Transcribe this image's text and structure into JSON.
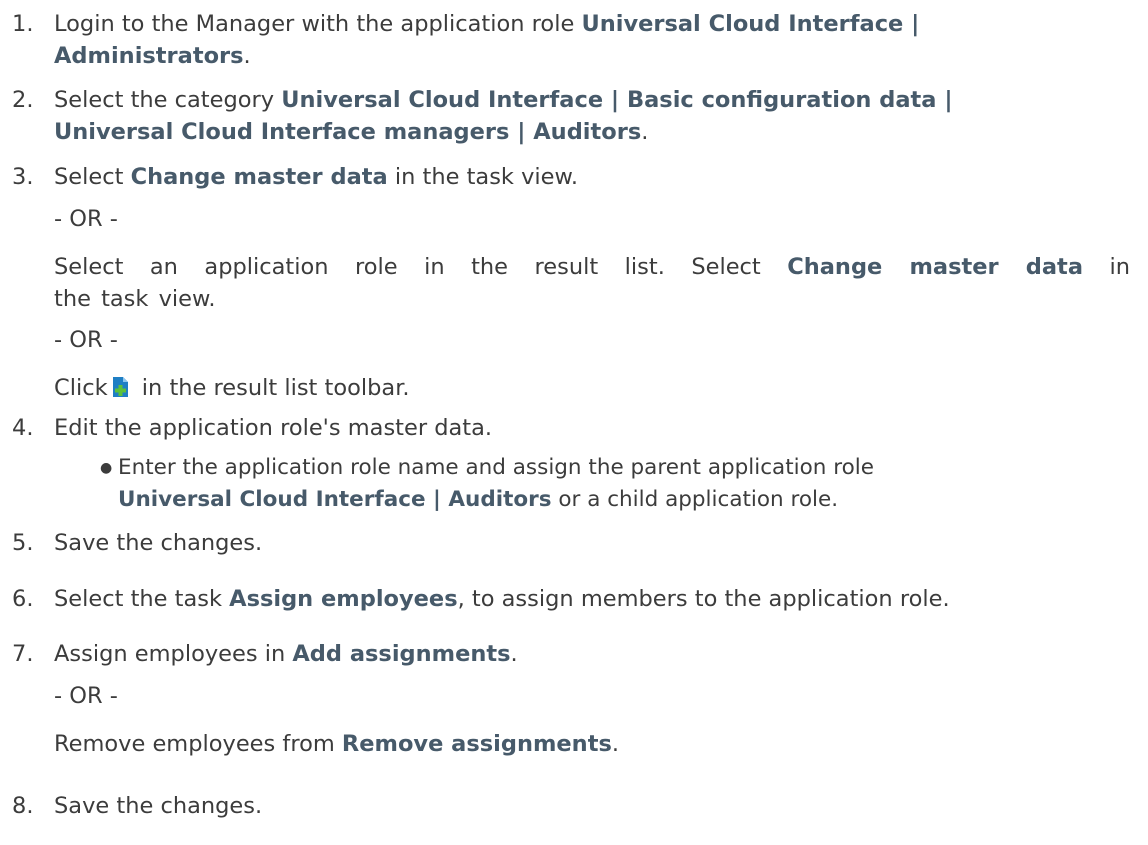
{
  "steps": [
    {
      "num": "1.",
      "lines": [
        {
          "pre": "Login to the Manager with the application role ",
          "bold": "Universal Cloud Interface |",
          "post": ""
        },
        {
          "pre": "",
          "bold": "Administrators",
          "post": "."
        }
      ]
    },
    {
      "num": "2.",
      "lines": [
        {
          "pre": "Select the category ",
          "bold": "Universal Cloud Interface | Basic configuration data |",
          "post": ""
        },
        {
          "pre": "",
          "bold": "Universal Cloud Interface managers | Auditors",
          "post": "."
        }
      ]
    },
    {
      "num": "3.",
      "line1": {
        "pre": "Select ",
        "bold": "Change master data",
        "post": " in the task view."
      },
      "or1": "- OR -",
      "line2a": {
        "pre": "Select an application role in the result list. Select ",
        "bold": "Change master data",
        "post": " in"
      },
      "line2b": "the task view.",
      "or2": "- OR -",
      "click_pre": "Click",
      "click_post": " in the result list toolbar.",
      "icon": "new-document-icon",
      "icon_color": "#1f7fc4",
      "icon_plus_color": "#5cc23a"
    },
    {
      "num": "4.",
      "text": "Edit the application role's master data.",
      "bullet_line1": "Enter the application role name and assign the parent application role",
      "bullet_bold": "Universal Cloud Interface | Auditors",
      "bullet_post": " or a child application role."
    },
    {
      "num": "5.",
      "text": "Save the changes."
    },
    {
      "num": "6.",
      "pre": "Select the task ",
      "bold": "Assign employees",
      "post": ", to assign members to the application role."
    },
    {
      "num": "7.",
      "pre": "Assign employees in ",
      "bold": "Add assignments",
      "post": ".",
      "or": "- OR -",
      "pre2": "Remove employees from ",
      "bold2": "Remove assignments",
      "post2": "."
    },
    {
      "num": "8.",
      "text": "Save the changes."
    }
  ]
}
